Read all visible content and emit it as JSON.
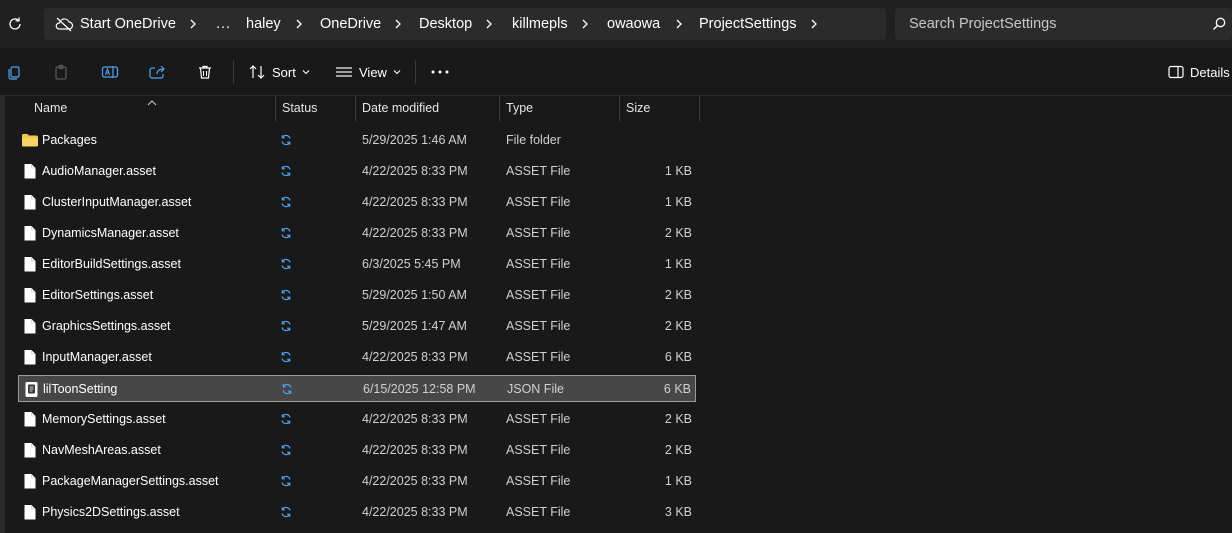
{
  "address_bar": {
    "crumbs": [
      "Start OneDrive",
      "...",
      "haley",
      "OneDrive",
      "Desktop",
      "killmepls",
      "owaowa",
      "ProjectSettings"
    ]
  },
  "search": {
    "placeholder": "Search ProjectSettings"
  },
  "toolbar": {
    "sort_label": "Sort",
    "view_label": "View",
    "details_label": "Details",
    "icons": [
      "copy-icon",
      "paste-icon",
      "rename-icon",
      "share-icon",
      "delete-icon",
      "sort-icon",
      "view-icon",
      "more-icon",
      "details-pane-icon"
    ]
  },
  "columns": [
    "Name",
    "Status",
    "Date modified",
    "Type",
    "Size"
  ],
  "files": [
    {
      "name": "Packages",
      "date": "5/29/2025 1:46 AM",
      "type": "File folder",
      "size": "",
      "icon": "folder-icon"
    },
    {
      "name": "AudioManager.asset",
      "date": "4/22/2025 8:33 PM",
      "type": "ASSET File",
      "size": "1 KB",
      "icon": "file-icon"
    },
    {
      "name": "ClusterInputManager.asset",
      "date": "4/22/2025 8:33 PM",
      "type": "ASSET File",
      "size": "1 KB",
      "icon": "file-icon"
    },
    {
      "name": "DynamicsManager.asset",
      "date": "4/22/2025 8:33 PM",
      "type": "ASSET File",
      "size": "2 KB",
      "icon": "file-icon"
    },
    {
      "name": "EditorBuildSettings.asset",
      "date": "6/3/2025 5:45 PM",
      "type": "ASSET File",
      "size": "1 KB",
      "icon": "file-icon"
    },
    {
      "name": "EditorSettings.asset",
      "date": "5/29/2025 1:50 AM",
      "type": "ASSET File",
      "size": "2 KB",
      "icon": "file-icon"
    },
    {
      "name": "GraphicsSettings.asset",
      "date": "5/29/2025 1:47 AM",
      "type": "ASSET File",
      "size": "2 KB",
      "icon": "file-icon"
    },
    {
      "name": "InputManager.asset",
      "date": "4/22/2025 8:33 PM",
      "type": "ASSET File",
      "size": "6 KB",
      "icon": "file-icon"
    },
    {
      "name": "lilToonSetting",
      "date": "6/15/2025 12:58 PM",
      "type": "JSON File",
      "size": "6 KB",
      "icon": "json-file-icon",
      "selected": true
    },
    {
      "name": "MemorySettings.asset",
      "date": "4/22/2025 8:33 PM",
      "type": "ASSET File",
      "size": "2 KB",
      "icon": "file-icon"
    },
    {
      "name": "NavMeshAreas.asset",
      "date": "4/22/2025 8:33 PM",
      "type": "ASSET File",
      "size": "2 KB",
      "icon": "file-icon"
    },
    {
      "name": "PackageManagerSettings.asset",
      "date": "4/22/2025 8:33 PM",
      "type": "ASSET File",
      "size": "1 KB",
      "icon": "file-icon"
    },
    {
      "name": "Physics2DSettings.asset",
      "date": "4/22/2025 8:33 PM",
      "type": "ASSET File",
      "size": "3 KB",
      "icon": "file-icon"
    }
  ],
  "colors": {
    "sync_blue": "#4ea3f2",
    "folder_yellow": "#f4c54b",
    "selection_bg": "#474747"
  }
}
